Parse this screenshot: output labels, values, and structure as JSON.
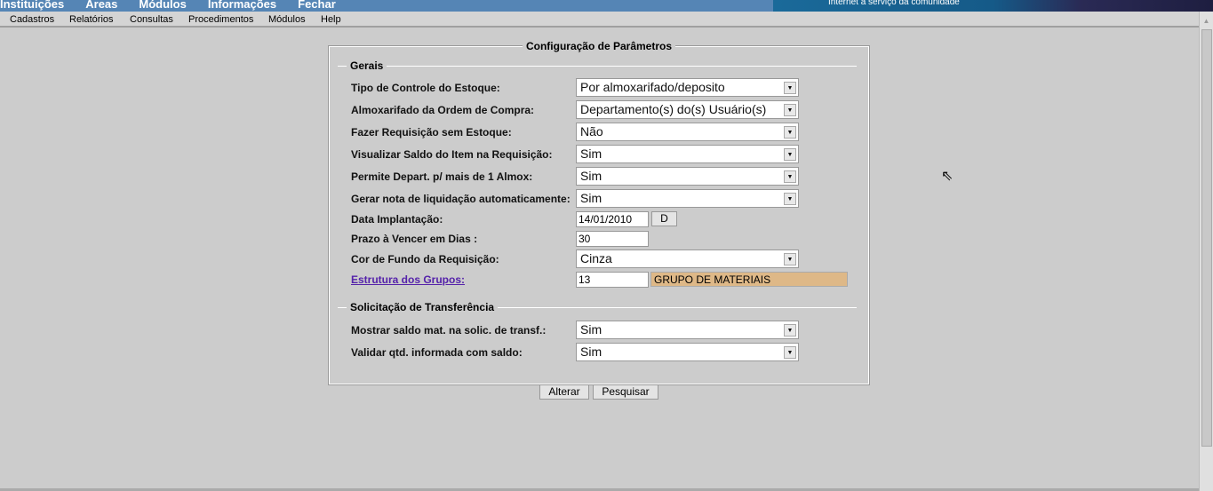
{
  "topmenu": [
    "Instituições",
    "Areas",
    "Módulos",
    "Informações",
    "Fechar"
  ],
  "banner_text": "Internet a serviço da comunidade",
  "menubar": [
    "Cadastros",
    "Relatórios",
    "Consultas",
    "Procedimentos",
    "Módulos",
    "Help"
  ],
  "panel_title": "Configuração de Parâmetros",
  "gerais": {
    "legend": "Gerais",
    "tipo_controle": {
      "label": "Tipo de Controle do Estoque:",
      "value": "Por almoxarifado/deposito"
    },
    "almox_ordem": {
      "label": "Almoxarifado da Ordem de Compra:",
      "value": "Departamento(s) do(s) Usuário(s)"
    },
    "req_sem_estoque": {
      "label": "Fazer Requisição sem Estoque:",
      "value": "Não"
    },
    "visualizar_saldo": {
      "label": "Visualizar Saldo do Item na Requisição:",
      "value": "Sim"
    },
    "permite_depart": {
      "label": "Permite Depart. p/ mais de 1 Almox:",
      "value": "Sim"
    },
    "gerar_nota": {
      "label": "Gerar nota de liquidação automaticamente:",
      "value": "Sim"
    },
    "data_implantacao": {
      "label": "Data Implantação:",
      "value": "14/01/2010",
      "button": "D"
    },
    "prazo": {
      "label": "Prazo à Vencer em Dias :",
      "value": "30"
    },
    "cor_fundo": {
      "label": "Cor de Fundo da Requisição:",
      "value": "Cinza"
    },
    "estrutura": {
      "label": "Estrutura dos Grupos:",
      "code": "13",
      "description": "GRUPO DE MATERIAIS"
    }
  },
  "transferencia": {
    "legend": "Solicitação de Transferência",
    "mostrar_saldo": {
      "label": "Mostrar saldo mat. na solic. de transf.:",
      "value": "Sim"
    },
    "validar_qtd": {
      "label": "Validar qtd. informada com saldo:",
      "value": "Sim"
    }
  },
  "buttons": {
    "alterar": "Alterar",
    "pesquisar": "Pesquisar"
  },
  "colors": {
    "topbar": "#5585b5",
    "description_bg": "#deb887",
    "link": "#5522aa"
  }
}
